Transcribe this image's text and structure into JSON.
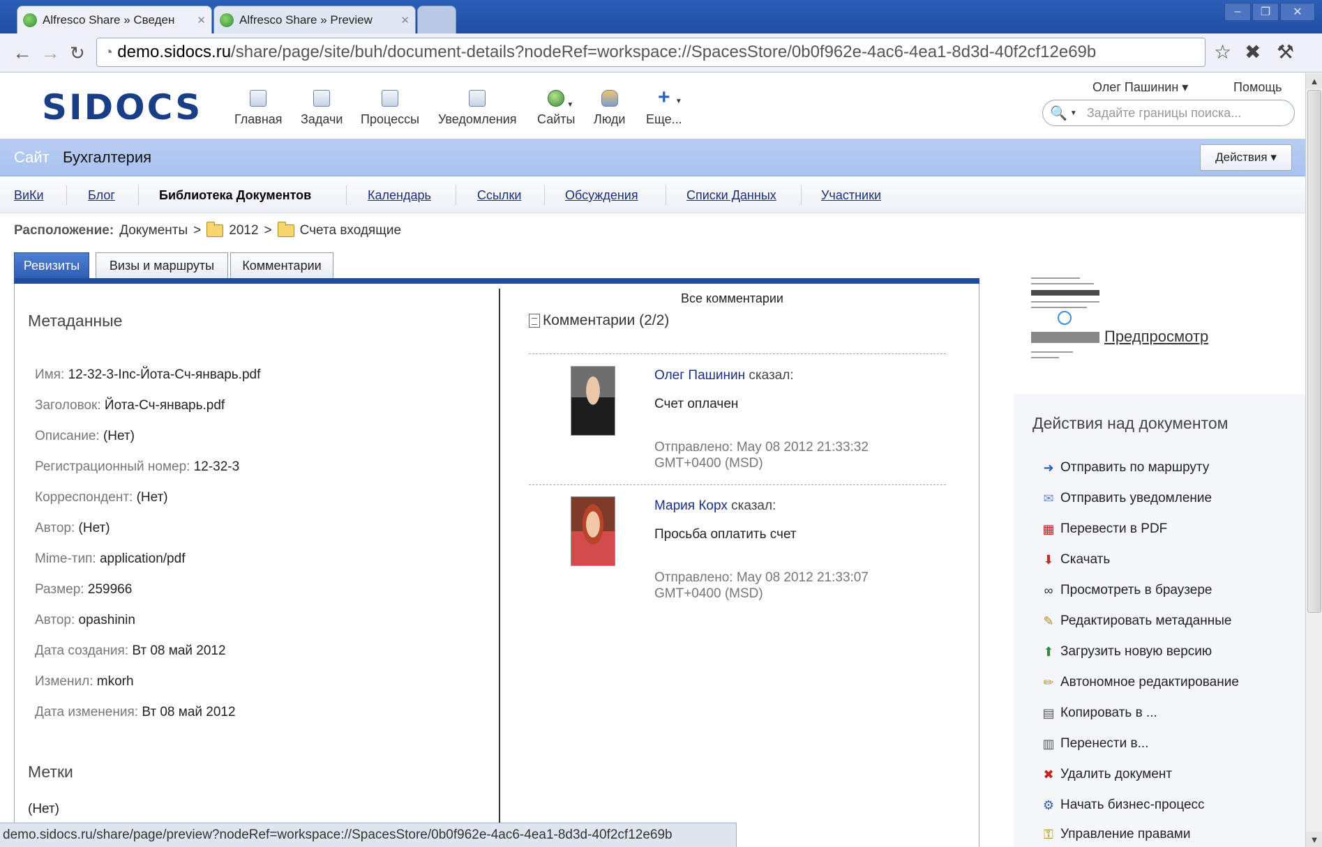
{
  "browser": {
    "tabs": [
      {
        "label": "Alfresco Share » Сведен",
        "active": true
      },
      {
        "label": "Alfresco Share » Preview",
        "active": false
      }
    ],
    "url_host": "demo.sidocs.ru",
    "url_path": "/share/page/site/buh/document-details?nodeRef=workspace://SpacesStore/0b0f962e-4ac6-4ea1-8d3d-40f2cf12e69b",
    "status_url": "demo.sidocs.ru/share/page/preview?nodeRef=workspace://SpacesStore/0b0f962e-4ac6-4ea1-8d3d-40f2cf12e69b"
  },
  "header": {
    "logo": "SIDOCS",
    "nav": [
      {
        "label": "Главная",
        "icon": "home-icon"
      },
      {
        "label": "Задачи",
        "icon": "tasks-icon"
      },
      {
        "label": "Процессы",
        "icon": "processes-icon"
      },
      {
        "label": "Уведомления",
        "icon": "notifications-icon"
      },
      {
        "label": "Сайты",
        "icon": "sites-icon"
      },
      {
        "label": "Люди",
        "icon": "people-icon"
      },
      {
        "label": "Еще...",
        "icon": "more-icon"
      }
    ],
    "user": "Олег Пашинин ▾",
    "help": "Помощь",
    "search_placeholder": "Задайте границы поиска..."
  },
  "site": {
    "label": "Сайт",
    "name": "Бухгалтерия",
    "actions": "Действия ▾",
    "nav": [
      "ВиКи",
      "Блог",
      "Библиотека Документов",
      "Календарь",
      "Ссылки",
      "Обсуждения",
      "Списки Данных",
      "Участники"
    ]
  },
  "breadcrumb": {
    "label": "Расположение:",
    "items": [
      "Документы",
      "2012",
      "Счета входящие"
    ],
    "separator": ">"
  },
  "tabs": [
    "Ревизиты",
    "Визы и маршруты",
    "Комментарии"
  ],
  "metadata": {
    "title": "Метаданные",
    "props": [
      {
        "label": "Имя:",
        "value": "12-32-3-Inc-Йота-Сч-январь.pdf"
      },
      {
        "label": "Заголовок:",
        "value": "Йота-Сч-январь.pdf"
      },
      {
        "label": "Описание:",
        "value": "(Нет)"
      },
      {
        "label": "Регистрационный номер:",
        "value": "12-32-3"
      },
      {
        "label": "Корреспондент:",
        "value": "(Нет)"
      },
      {
        "label": "Автор:",
        "value": "(Нет)"
      },
      {
        "label": "Mime-тип:",
        "value": "application/pdf"
      },
      {
        "label": "Размер:",
        "value": "259966"
      },
      {
        "label": "Автор:",
        "value": "opashinin"
      },
      {
        "label": "Дата создания:",
        "value": "Вт 08 май 2012"
      },
      {
        "label": "Изменил:",
        "value": "mkorh"
      },
      {
        "label": "Дата изменения:",
        "value": "Вт 08 май 2012"
      }
    ],
    "tags_title": "Метки",
    "tags_value": "(Нет)"
  },
  "comments": {
    "all_label": "Все комментарии",
    "header": "Комментарии (2/2)",
    "items": [
      {
        "author": "Олег Пашинин",
        "said": " сказал:",
        "text": "Счет оплачен",
        "date": "Отправлено: May 08 2012 21:33:32 GMT+0400 (MSD)"
      },
      {
        "author": "Мария Корх",
        "said": " сказал:",
        "text": "Просьба оплатить счет",
        "date": "Отправлено: May 08 2012 21:33:07 GMT+0400 (MSD)"
      }
    ]
  },
  "preview": {
    "label": "Предпросмотр"
  },
  "doc_actions": {
    "title": "Действия над документом",
    "items": [
      {
        "label": "Отправить по маршруту",
        "icon": "route-arrow-icon"
      },
      {
        "label": "Отправить уведомление",
        "icon": "envelope-icon"
      },
      {
        "label": "Перевести в PDF",
        "icon": "pdf-icon"
      },
      {
        "label": "Скачать",
        "icon": "download-icon"
      },
      {
        "label": "Просмотреть в браузере",
        "icon": "binoculars-icon"
      },
      {
        "label": "Редактировать метаданные",
        "icon": "edit-metadata-icon"
      },
      {
        "label": "Загрузить новую версию",
        "icon": "upload-version-icon"
      },
      {
        "label": "Автономное редактирование",
        "icon": "pencil-icon"
      },
      {
        "label": "Копировать в ...",
        "icon": "copy-icon"
      },
      {
        "label": "Перенести в...",
        "icon": "move-icon"
      },
      {
        "label": "Удалить документ",
        "icon": "delete-icon"
      },
      {
        "label": "Начать бизнес-процесс",
        "icon": "workflow-icon"
      },
      {
        "label": "Управление правами",
        "icon": "permissions-icon"
      }
    ]
  }
}
